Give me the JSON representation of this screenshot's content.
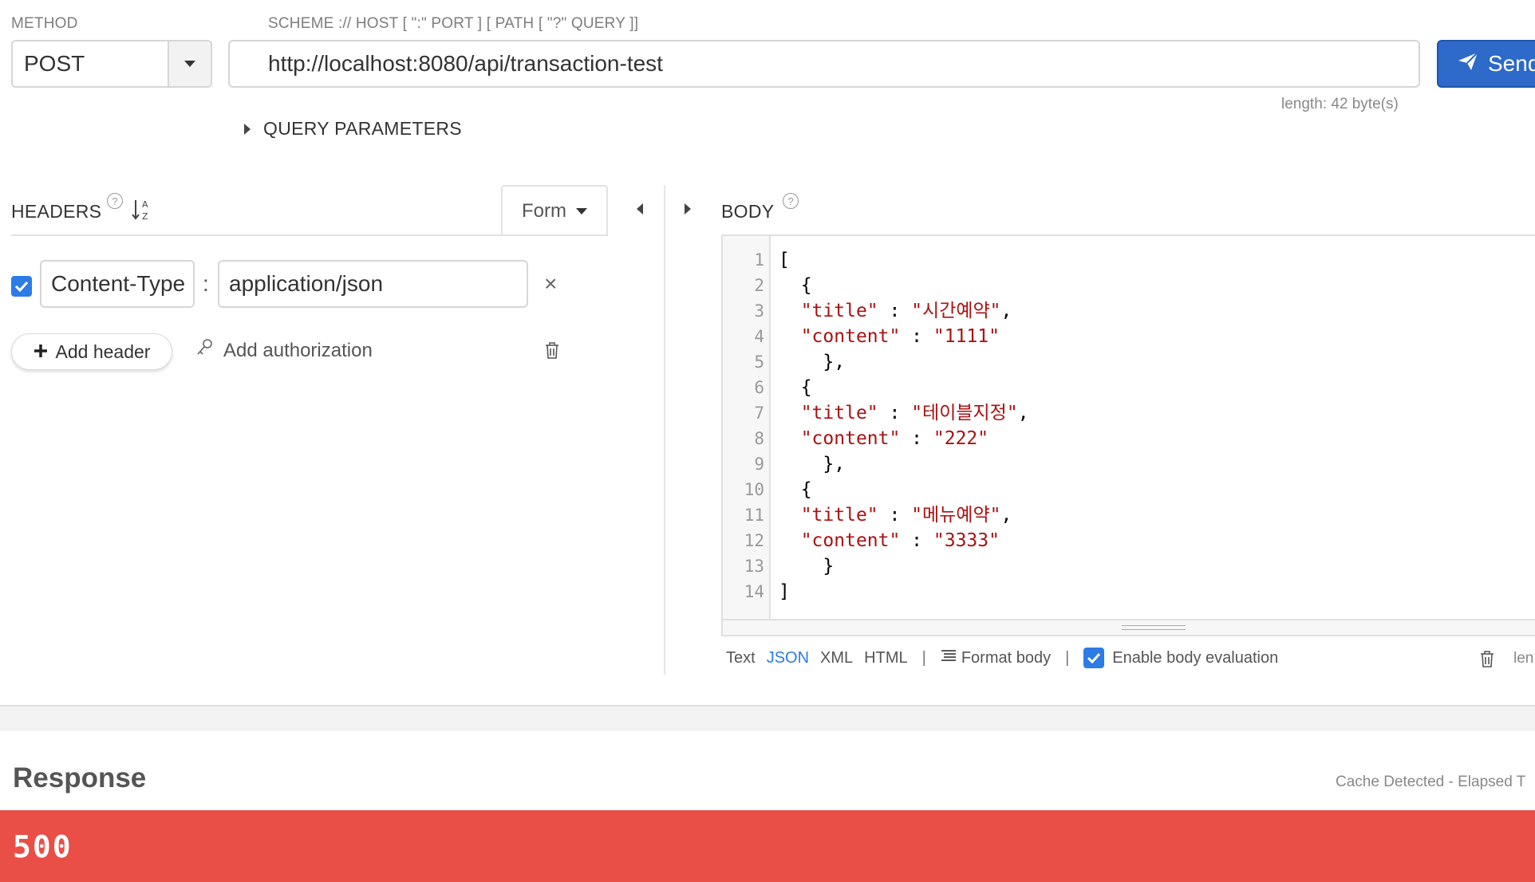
{
  "request": {
    "method_label": "METHOD",
    "method_value": "POST",
    "url_label": "SCHEME :// HOST [ \":\" PORT ] [ PATH [ \"?\" QUERY ]]",
    "url_value": "http://localhost:8080/api/transaction-test",
    "send_label": "Send",
    "length_info": "length: 42 byte(s)",
    "query_params_label": "QUERY PARAMETERS"
  },
  "headers": {
    "title": "HEADERS",
    "help": "?",
    "mode_label": "Form",
    "rows": [
      {
        "enabled": true,
        "key": "Content-Type",
        "separator": ":",
        "value": "application/json",
        "remove": "×"
      }
    ],
    "add_header_label": "Add header",
    "add_authorization_label": "Add authorization"
  },
  "body": {
    "title": "BODY",
    "help": "?",
    "line_numbers": [
      "1",
      "2",
      "3",
      "4",
      "5",
      "6",
      "7",
      "8",
      "9",
      "10",
      "11",
      "12",
      "13",
      "14"
    ],
    "toolbar": {
      "formats": [
        "Text",
        "JSON",
        "XML",
        "HTML"
      ],
      "active_format": "JSON",
      "separator": "|",
      "format_body_label": "Format body",
      "enable_eval_label": "Enable body evaluation",
      "enable_eval_checked": true,
      "length_partial": "len"
    }
  },
  "response": {
    "title": "Response",
    "cache_info": "Cache Detected - Elapsed T",
    "status_code": "500",
    "status_color": "#e94e47"
  },
  "colors": {
    "accent": "#2d7be5",
    "send_button": "#2d6ac9",
    "string_literal": "#aa1111"
  },
  "icons": {
    "method_dropdown": "caret-down-icon",
    "send": "paper-plane-icon",
    "query_toggle": "caret-right-icon",
    "sort": "sort-alpha-icon",
    "add": "plus-icon",
    "auth": "key-icon",
    "delete": "trash-icon",
    "collapse_left": "caret-left-icon",
    "collapse_right": "caret-right-icon",
    "format": "align-left-icon"
  }
}
